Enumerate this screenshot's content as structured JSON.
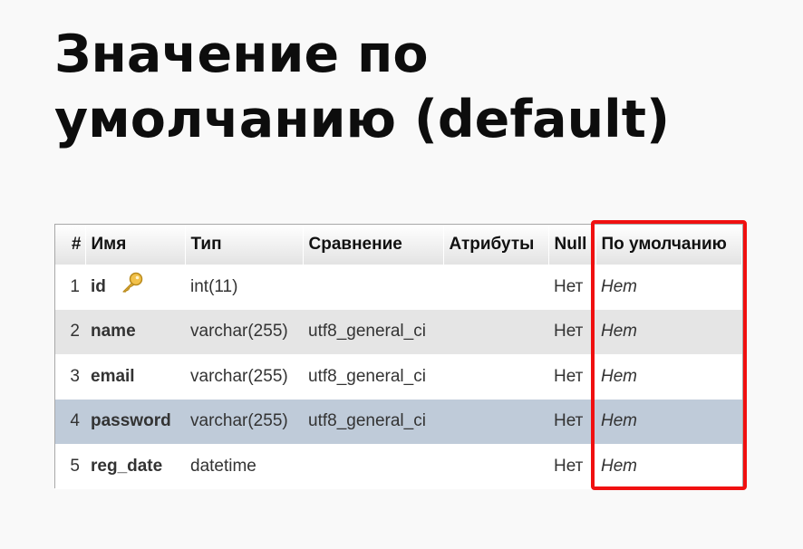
{
  "slide": {
    "title_line1": "Значение по",
    "title_line2": "умолчанию (default)"
  },
  "table": {
    "columns": [
      "#",
      "Имя",
      "Тип",
      "Сравнение",
      "Атрибуты",
      "Null",
      "По умолчанию"
    ],
    "rows": [
      {
        "num": "1",
        "name": "id",
        "type": "int(11)",
        "collation": "",
        "attributes": "",
        "null": "Нет",
        "default": "Нет",
        "icon": "key-icon",
        "state": "normal"
      },
      {
        "num": "2",
        "name": "name",
        "type": "varchar(255)",
        "collation": "utf8_general_ci",
        "attributes": "",
        "null": "Нет",
        "default": "Нет",
        "state": "normal"
      },
      {
        "num": "3",
        "name": "email",
        "type": "varchar(255)",
        "collation": "utf8_general_ci",
        "attributes": "",
        "null": "Нет",
        "default": "Нет",
        "state": "normal"
      },
      {
        "num": "4",
        "name": "password",
        "type": "varchar(255)",
        "collation": "utf8_general_ci",
        "attributes": "",
        "null": "Нет",
        "default": "Нет",
        "state": "selected"
      },
      {
        "num": "5",
        "name": "reg_date",
        "type": "datetime",
        "collation": "",
        "attributes": "",
        "null": "Нет",
        "default": "Нет",
        "state": "normal"
      }
    ]
  },
  "colors": {
    "highlight": "#f01010",
    "selected_row": "#bfcbd9",
    "striped_row": "#e5e5e5"
  }
}
